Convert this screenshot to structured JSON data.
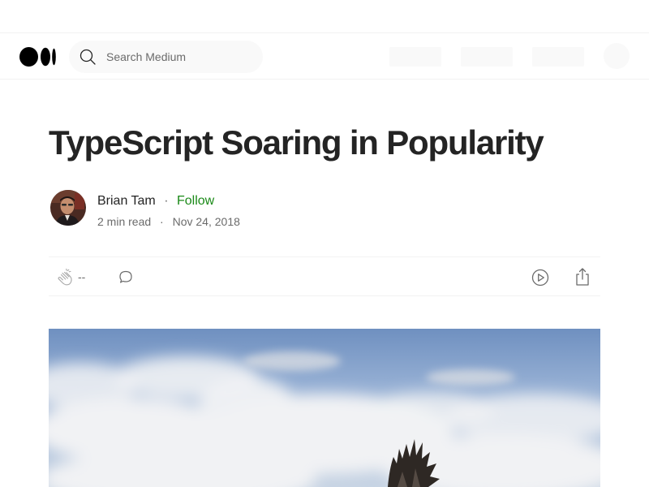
{
  "header": {
    "logo_icon": "medium-logo-icon",
    "search": {
      "placeholder": "Search Medium",
      "icon": "search-icon"
    },
    "colors": {
      "border": "#f2f2f2",
      "placeholder_bg": "#f9f9f9"
    }
  },
  "article": {
    "title": "TypeScript Soaring in Popularity",
    "author": {
      "name": "Brian Tam",
      "separator": "·",
      "follow_label": "Follow",
      "avatar_icon": "author-avatar-photo"
    },
    "meta": {
      "read_time": "2 min read",
      "separator": "·",
      "date": "Nov 24, 2018"
    },
    "actions": {
      "clap_icon": "clap-icon",
      "clap_count": "--",
      "comment_icon": "comment-icon",
      "listen_icon": "play-circle-icon",
      "share_icon": "share-icon"
    },
    "hero_image": "soaring-bird-sky-photo"
  },
  "colors": {
    "text": "#242424",
    "muted": "#6b6b6b",
    "follow_green": "#1a8917",
    "sky_blue": "#7d9ecb"
  }
}
